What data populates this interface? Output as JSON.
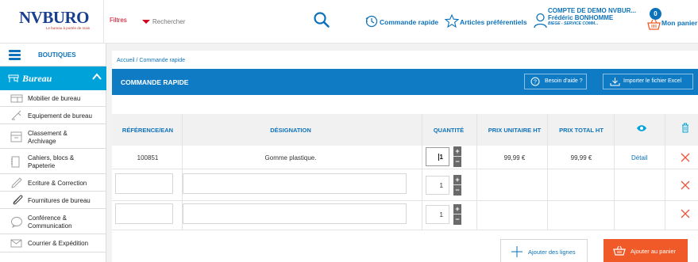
{
  "header": {
    "logo_text": "NVBURO",
    "logo_tagline": "Le bureau à portée de main",
    "filters_label": "Filtres",
    "search_placeholder": "Rechercher",
    "quick_order_label": "Commande rapide",
    "favorites_label": "Articles préférentiels",
    "account_line1": "COMPTE DE DEMO NVBUR...",
    "account_line2": "Frédéric BONHOMME",
    "account_line3": "BIEGE - SERVICE COMM...",
    "cart_count": "0",
    "cart_label": "Mon panier"
  },
  "sidebar": {
    "boutiques_label": "BOUTIQUES",
    "active_category": "Bureau",
    "items": [
      {
        "label": "Mobilier de bureau",
        "icon": "furniture-icon"
      },
      {
        "label": "Equipement de bureau",
        "icon": "equipment-icon"
      },
      {
        "label": "Classement &\nArchivage",
        "icon": "archive-icon"
      },
      {
        "label": "Cahiers, blocs &\nPapeterie",
        "icon": "notebook-icon"
      },
      {
        "label": "Ecriture & Correction",
        "icon": "pen-icon"
      },
      {
        "label": "Fournitures de bureau",
        "icon": "paperclip-icon"
      },
      {
        "label": "Conférence &\nCommunication",
        "icon": "chat-bubble-icon"
      },
      {
        "label": "Courrier & Expédition",
        "icon": "envelope-icon"
      }
    ]
  },
  "main": {
    "breadcrumb": "Accueil / Commande rapide",
    "title": "COMMANDE RAPIDE",
    "help_button": "Besoin d'aide ?",
    "import_button": "Importer le fichier Excel",
    "columns": {
      "reference": "RÉFÉRENCE/EAN",
      "designation": "DÉSIGNATION",
      "quantity": "QUANTITÉ",
      "unit_price": "PRIX UNITAIRE HT",
      "total_price": "PRIX TOTAL HT"
    },
    "rows": [
      {
        "reference": "100851",
        "designation": "Gomme plastique.",
        "quantity": "1",
        "unit_price": "99,99 €",
        "total_price": "99,99 €",
        "detail": "Détail"
      },
      {
        "reference": "",
        "designation": "",
        "quantity": "1",
        "unit_price": "",
        "total_price": "",
        "detail": ""
      },
      {
        "reference": "",
        "designation": "",
        "quantity": "1",
        "unit_price": "",
        "total_price": "",
        "detail": ""
      }
    ],
    "add_lines_button": "Ajouter des lignes",
    "add_to_cart_button": "Ajouter au panier"
  },
  "colors": {
    "brand_blue": "#0d72b9",
    "title_bar": "#0f7bc4",
    "sidebar_active": "#00a3d9",
    "accent_red": "#d0021b",
    "cart_button": "#f05a28"
  }
}
